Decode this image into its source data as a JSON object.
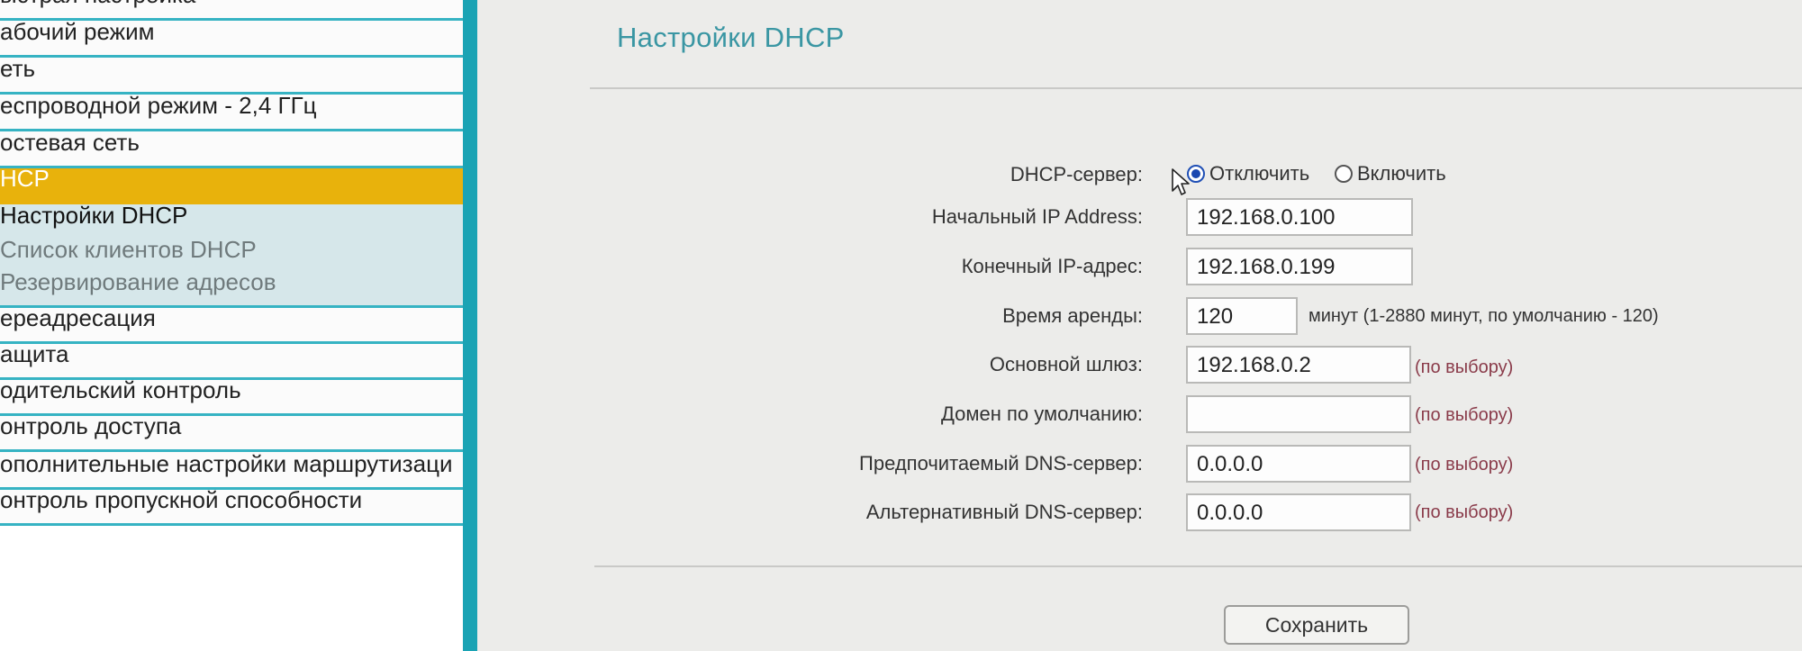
{
  "sidebar": {
    "items": [
      {
        "label": "ыстрая настройка"
      },
      {
        "label": "абочий режим"
      },
      {
        "label": "еть"
      },
      {
        "label": "еспроводной режим - 2,4 ГГц"
      },
      {
        "label": "остевая сеть"
      },
      {
        "label": "HCP"
      },
      {
        "label": "Настройки DHCP"
      },
      {
        "label": "Список клиентов DHCP"
      },
      {
        "label": "Резервирование адресов"
      },
      {
        "label": "ереадресация"
      },
      {
        "label": "ащита"
      },
      {
        "label": "одительский контроль"
      },
      {
        "label": "онтроль доступа"
      },
      {
        "label": "ополнительные настройки маршрутизаци"
      },
      {
        "label": "онтроль пропускной способности"
      }
    ]
  },
  "main": {
    "title": "Настройки DHCP",
    "dhcp_server": {
      "label": "DHCP-сервер:",
      "options": [
        "Отключить",
        "Включить"
      ],
      "selected": "Отключить"
    },
    "fields": {
      "start_ip": {
        "label": "Начальный IP Address:",
        "value": "192.168.0.100"
      },
      "end_ip": {
        "label": "Конечный IP-адрес:",
        "value": "192.168.0.199"
      },
      "lease_time": {
        "label": "Время аренды:",
        "value": "120",
        "hint": "минут (1-2880 минут, по умолчанию - 120)"
      },
      "gateway": {
        "label": "Основной шлюз:",
        "value": "192.168.0.2",
        "note": "(по выбору)"
      },
      "domain": {
        "label": "Домен по умолчанию:",
        "value": "",
        "note": "(по выбору)"
      },
      "primary_dns": {
        "label": "Предпочитаемый DNS-сервер:",
        "value": "0.0.0.0",
        "note": "(по выбору)"
      },
      "secondary_dns": {
        "label": "Альтернативный DNS-сервер:",
        "value": "0.0.0.0",
        "note": "(по выбору)"
      }
    },
    "save_label": "Сохранить"
  },
  "colors": {
    "accent": "#1aa3b4",
    "active": "#e8b20c",
    "title": "#3a96a3",
    "optional_note": "#8a3b4a"
  },
  "icons": {
    "cursor": "mouse-pointer-icon"
  }
}
